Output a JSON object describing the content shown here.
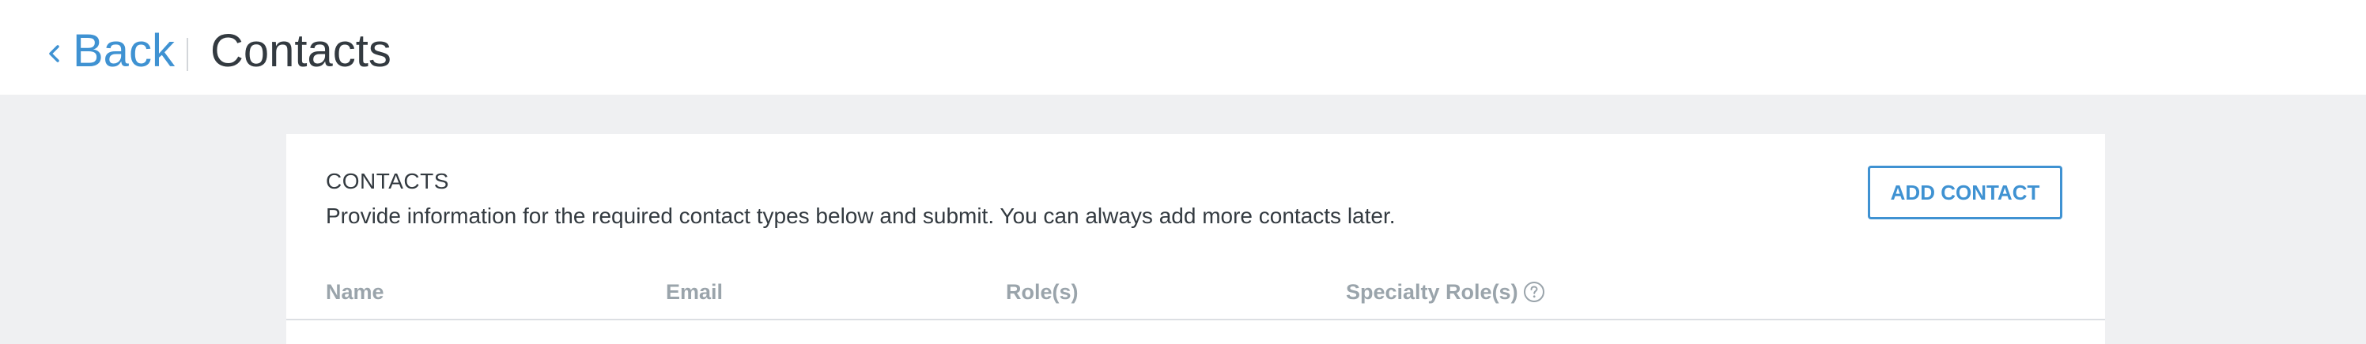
{
  "header": {
    "back_label": "Back",
    "title": "Contacts"
  },
  "contacts_section": {
    "title": "CONTACTS",
    "description": "Provide information for the required contact types below and submit. You can always add more contacts later.",
    "add_button_label": "ADD CONTACT"
  },
  "table": {
    "columns": [
      "Name",
      "Email",
      "Role(s)",
      "Specialty Role(s)"
    ]
  },
  "icons": {
    "back": "chevron-left-icon",
    "help": "question-circle-icon"
  },
  "colors": {
    "accent": "#3f92d2",
    "header_text": "#9aa4ab",
    "body_text": "#333a40",
    "page_background": "#eff0f2"
  }
}
